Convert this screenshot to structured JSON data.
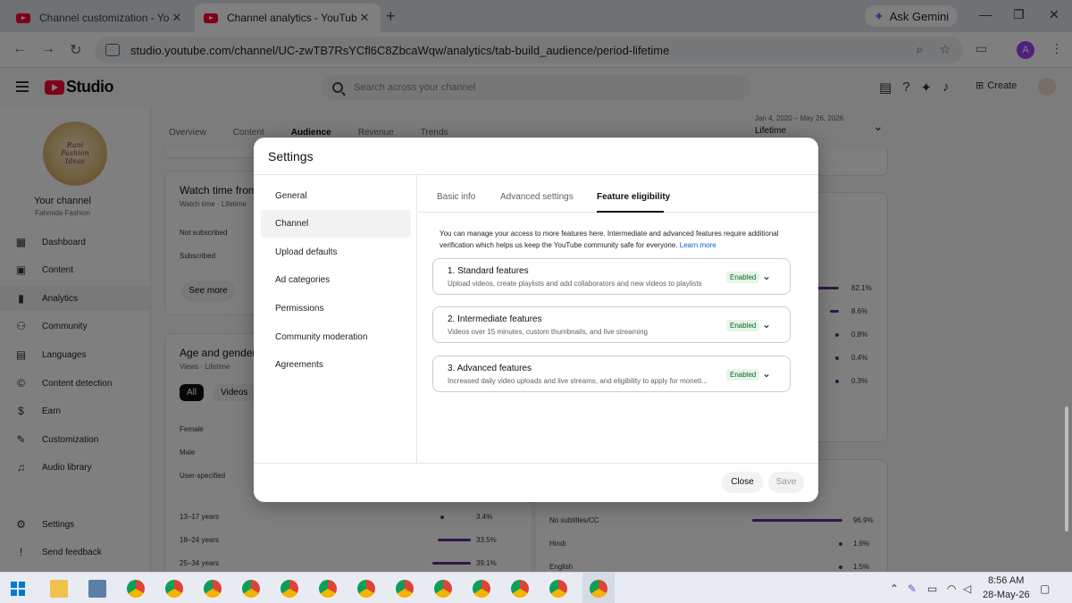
{
  "browser": {
    "tabs": [
      {
        "title": "Channel customization - YouTube Studio",
        "close": "✕"
      },
      {
        "title": "Channel analytics - YouTube Studio",
        "close": "✕"
      }
    ],
    "new_tab": "+",
    "gemini_label": "Ask Gemini",
    "url": "studio.youtube.com/channel/UC-zwTB7RsYCfl6C8ZbcaWqw/analytics/tab-build_audience/period-lifetime",
    "profile_initial": "A"
  },
  "studio": {
    "logo_text": "Studio",
    "search_placeholder": "Search across your channel",
    "create_label": "Create"
  },
  "sidebar": {
    "channel_art_text": "Rani Fashion Ideas",
    "your_channel": "Your channel",
    "channel_name": "Fahmida Fashion",
    "items": [
      {
        "label": "Dashboard",
        "icon": "▦"
      },
      {
        "label": "Content",
        "icon": "▣"
      },
      {
        "label": "Analytics",
        "icon": "▮"
      },
      {
        "label": "Community",
        "icon": "⚇"
      },
      {
        "label": "Languages",
        "icon": "▤"
      },
      {
        "label": "Content detection",
        "icon": "©"
      },
      {
        "label": "Earn",
        "icon": "$"
      },
      {
        "label": "Customization",
        "icon": "✎"
      },
      {
        "label": "Audio library",
        "icon": "♫"
      }
    ],
    "settings": "Settings",
    "send_feedback": "Send feedback"
  },
  "main": {
    "tabs": [
      "Overview",
      "Content",
      "Audience",
      "Revenue",
      "Trends"
    ],
    "date_range": "Jan 4, 2020 – May 26, 2026",
    "date_label": "Lifetime",
    "watch_card": {
      "title": "Watch time from",
      "sub": "Watch time · Lifetime",
      "rows": [
        "Not subscribed",
        "Subscribed"
      ],
      "see_more": "See more"
    },
    "age_card": {
      "title": "Age and gender",
      "sub": "Views · Lifetime",
      "chip_all": "All",
      "chip_videos": "Videos",
      "rows": [
        "Female",
        "Male",
        "User-specified"
      ]
    },
    "age_rows": [
      {
        "label": "13–17 years",
        "pct": "3.4%",
        "value": 3.4
      },
      {
        "label": "18–24 years",
        "pct": "33.5%",
        "value": 33.5
      },
      {
        "label": "25–34 years",
        "pct": "39.1%",
        "value": 39.1
      }
    ],
    "right_pcts": [
      "82.1%",
      "8.6%",
      "0.8%",
      "0.4%",
      "0.3%"
    ],
    "subtitle_rows": [
      {
        "label": "No subtitles/CC",
        "pct": "96.9%",
        "value": 96.9
      },
      {
        "label": "Hindi",
        "pct": "1.6%",
        "value": 1.6
      },
      {
        "label": "English",
        "pct": "1.5%",
        "value": 1.5
      }
    ]
  },
  "modal": {
    "title": "Settings",
    "nav": [
      "General",
      "Channel",
      "Upload defaults",
      "Ad categories",
      "Permissions",
      "Community moderation",
      "Agreements"
    ],
    "tabs": [
      "Basic info",
      "Advanced settings",
      "Feature eligibility"
    ],
    "intro": "You can manage your access to more features here. Intermediate and advanced features require additional verification which helps us keep the YouTube community safe for everyone.",
    "learn_more": "Learn more",
    "features": [
      {
        "title": "1. Standard features",
        "desc": "Upload videos, create playlists and add collaborators and new videos to playlists",
        "status": "Enabled"
      },
      {
        "title": "2. Intermediate features",
        "desc": "Videos over 15 minutes, custom thumbnails, and live streaming",
        "status": "Enabled"
      },
      {
        "title": "3. Advanced features",
        "desc": "Increased daily video uploads and live streams, and eligibility to apply for moneti...",
        "status": "Enabled"
      }
    ],
    "close_label": "Close",
    "save_label": "Save"
  },
  "taskbar": {
    "time": "8:56 AM",
    "date": "28-May-26"
  },
  "colors": {
    "accent_bar": "#6a2c91",
    "youtube_red": "#ff0033",
    "link": "#065fd4",
    "enabled_green": "#0b6b1f"
  }
}
